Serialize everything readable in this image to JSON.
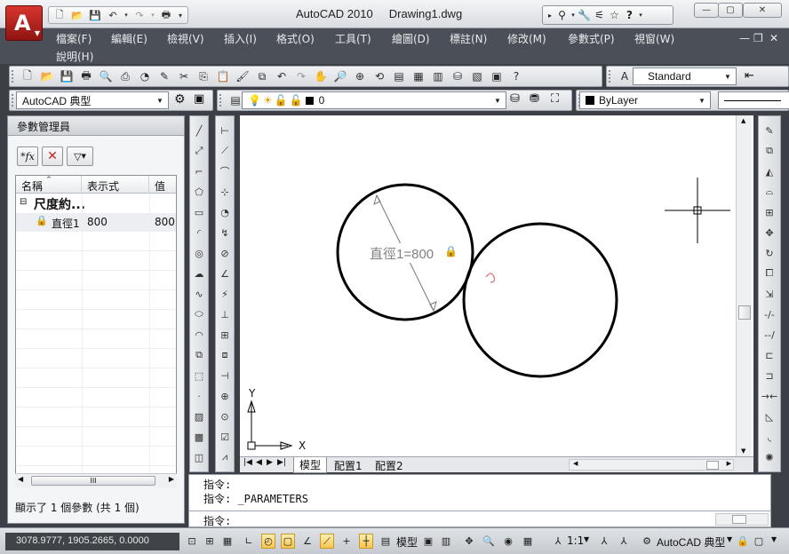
{
  "title": {
    "app_name": "AutoCAD 2010",
    "document": "Drawing1.dwg"
  },
  "menu": [
    "檔案(F)",
    "編輯(E)",
    "檢視(V)",
    "插入(I)",
    "格式(O)",
    "工具(T)",
    "繪圖(D)",
    "標註(N)",
    "修改(M)",
    "參數式(P)",
    "視窗(W)",
    "說明(H)"
  ],
  "toolbar": {
    "text_style": "Standard",
    "workspace": "AutoCAD 典型",
    "layer": "0",
    "color": "ByLayer"
  },
  "param_manager": {
    "title": "參數管理員",
    "columns": [
      "名稱",
      "表示式",
      "值"
    ],
    "group_label": "尺度約...",
    "rows": [
      {
        "name": "直徑1",
        "expression": "800",
        "value": "800"
      }
    ],
    "scroll_label": "III",
    "status": "顯示了 1 個參數 (共 1 個)"
  },
  "drawing": {
    "dimension_label": "直徑1=800",
    "axis_x": "X",
    "axis_y": "Y"
  },
  "layout_tabs": [
    "模型",
    "配置1",
    "配置2"
  ],
  "command": {
    "prompt": "指令:",
    "history": [
      "指令:",
      "指令: _PARAMETERS"
    ]
  },
  "status": {
    "coordinates": "3078.9777, 1905.2665, 0.0000",
    "space": "模型",
    "scale": "1:1",
    "workspace": "AutoCAD 典型"
  },
  "colors": {
    "accent_app": "#b8211b",
    "toggle_on": "#f6c64e"
  }
}
